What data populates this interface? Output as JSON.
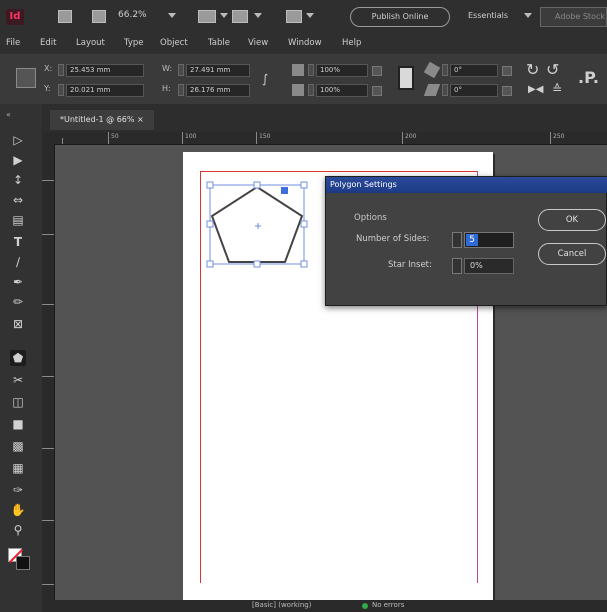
{
  "app": {
    "logo": "Id",
    "zoom": "66.2%",
    "workspace": "Publish Online",
    "essentials": "Essentials",
    "stock_search": "Adobe Stock"
  },
  "menu": [
    "File",
    "Edit",
    "Layout",
    "Type",
    "Object",
    "Table",
    "View",
    "Window",
    "Help"
  ],
  "control": {
    "x_label": "X:",
    "x_value": "25.453 mm",
    "y_label": "Y:",
    "y_value": "20.021 mm",
    "w_label": "W:",
    "w_value": "27.491 mm",
    "h_label": "H:",
    "h_value": "26.176 mm",
    "scale_x": "100%",
    "scale_y": "100%",
    "rotate": "0°",
    "shear": "0°"
  },
  "document_tab": "*Untitled-1 @ 66% ×",
  "ruler": [
    "50",
    "100",
    "150",
    "200",
    "250"
  ],
  "dialog": {
    "title": "Polygon Settings",
    "options_label": "Options",
    "sides_label": "Number of Sides:",
    "sides_value": "5",
    "inset_label": "Star Inset:",
    "inset_value": "0%",
    "ok_label": "OK",
    "cancel_label": "Cancel"
  },
  "status": {
    "text": "[Basic] (working)",
    "indicator": "No errors"
  },
  "colors": {
    "accent": "#2f6bd6",
    "brand": "#ff3366",
    "margin_left": "#dd3333",
    "margin_right": "#b54ca0"
  }
}
